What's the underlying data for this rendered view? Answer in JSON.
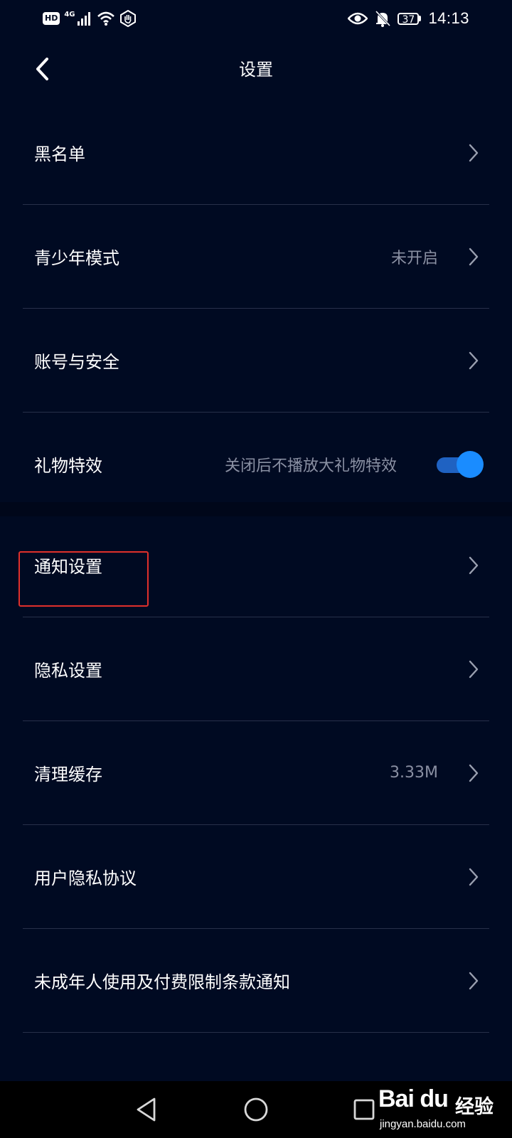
{
  "status_bar": {
    "hd_badge": "HD",
    "network_label": "4G",
    "battery_level": "37",
    "time": "14:13",
    "icons": [
      "hd-icon",
      "signal-icon",
      "wifi-icon",
      "hand-icon",
      "eye-icon",
      "mute-bell-icon",
      "battery-icon"
    ]
  },
  "header": {
    "title": "设置",
    "back_icon": "chevron-left-icon"
  },
  "section_1": {
    "items": [
      {
        "label": "黑名单",
        "value": "",
        "control": "chevron"
      },
      {
        "label": "青少年模式",
        "value": "未开启",
        "control": "chevron"
      },
      {
        "label": "账号与安全",
        "value": "",
        "control": "chevron"
      },
      {
        "label": "礼物特效",
        "value": "关闭后不播放大礼物特效",
        "control": "toggle",
        "toggle_on": true
      }
    ]
  },
  "section_2": {
    "items": [
      {
        "label": "通知设置",
        "value": "",
        "control": "chevron",
        "highlighted": true
      },
      {
        "label": "隐私设置",
        "value": "",
        "control": "chevron"
      },
      {
        "label": "清理缓存",
        "value": "3.33M",
        "control": "chevron"
      },
      {
        "label": "用户隐私协议",
        "value": "",
        "control": "chevron"
      },
      {
        "label": "未成年人使用及付费限制条款通知",
        "value": "",
        "control": "chevron"
      }
    ]
  },
  "system_nav": {
    "buttons": [
      "back-triangle-icon",
      "home-circle-icon",
      "recents-square-icon"
    ]
  },
  "watermark": {
    "logo": "Bai du",
    "tag": "经验",
    "url": "jingyan.baidu.com"
  },
  "colors": {
    "background": "#000a22",
    "divider": "#28304a",
    "secondary_text": "#8a90a3",
    "toggle_on": "#1a8cff",
    "highlight": "#e0302b"
  }
}
